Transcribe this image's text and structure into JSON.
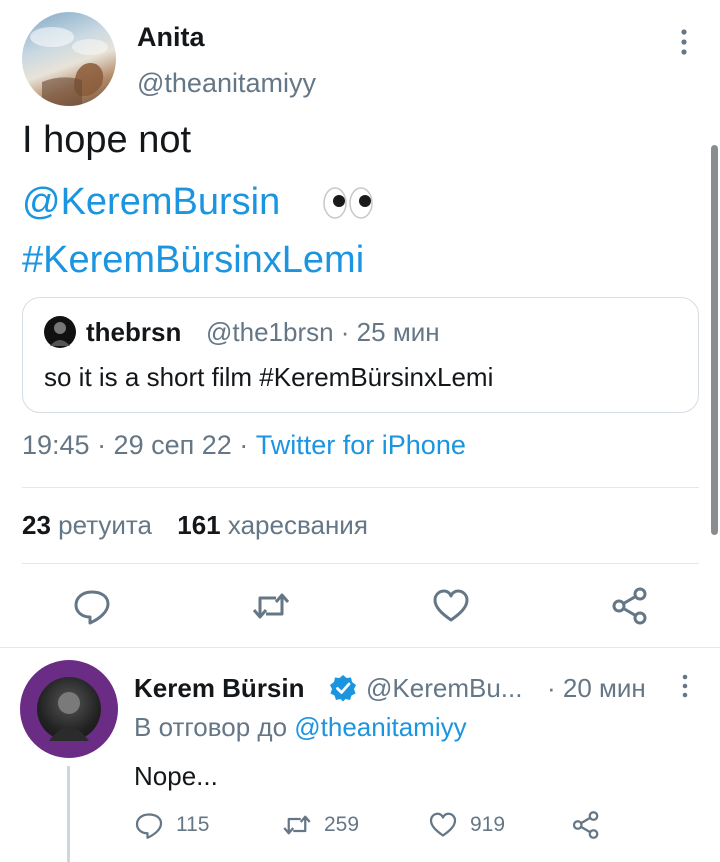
{
  "tweet": {
    "author_name": "Anita",
    "author_handle": "@theanitamiyy",
    "text_line1": "I hope not",
    "mention": "@KeremBursin",
    "hashtag": "#KeremBürsinxLemi",
    "timestamp": "19:45 · 29 сеп 22 · ",
    "source": "Twitter for iPhone"
  },
  "quoted_tweet": {
    "author_name": "thebrsn",
    "meta": "@the1brsn · 25 мин",
    "text": "so it is a short film #KeremBürsinxLemi"
  },
  "stats": {
    "retweet_count": "23",
    "retweet_label": "ретуита",
    "like_count": "161",
    "like_label": "харесвания"
  },
  "reply": {
    "author_name": "Kerem Bürsin",
    "author_handle": "@KeremBu...",
    "time": "· 20 мин",
    "reply_to_label": "В отговор до ",
    "reply_to_mention": "@theanitamiyy",
    "text": "Nope...",
    "reply_count": "115",
    "retweet_count": "259",
    "like_count": "919"
  },
  "colors": {
    "link": "#1b95e0",
    "secondary_text": "#657786",
    "avatar_ring": "#6a2c84"
  },
  "icons": [
    "more-vertical-icon",
    "eyes-emoji-icon",
    "reply-icon",
    "retweet-icon",
    "like-icon",
    "share-icon",
    "verified-badge-icon"
  ]
}
